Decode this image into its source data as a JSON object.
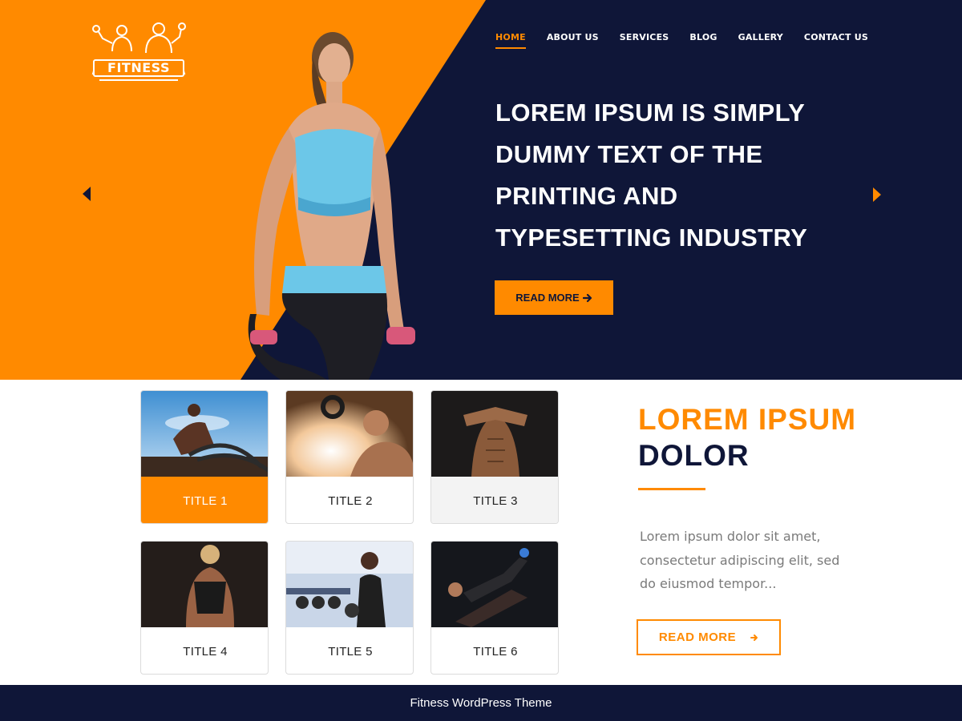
{
  "brand": {
    "logo_text": "FITNESS"
  },
  "colors": {
    "accent": "#ff8a00",
    "navy": "#0f1638"
  },
  "nav": {
    "items": [
      {
        "label": "HOME",
        "active": true
      },
      {
        "label": "ABOUT US"
      },
      {
        "label": "SERVICES"
      },
      {
        "label": "BLOG"
      },
      {
        "label": "GALLERY"
      },
      {
        "label": "CONTACT US"
      }
    ]
  },
  "hero": {
    "title": "LOREM IPSUM IS SIMPLY DUMMY TEXT OF THE PRINTING AND TYPESETTING INDUSTRY",
    "button_label": "READ MORE",
    "button_icon": "arrow-right-icon",
    "prev_icon": "caret-left-icon",
    "next_icon": "caret-right-icon"
  },
  "cards": [
    {
      "title": "TITLE 1"
    },
    {
      "title": "TITLE 2"
    },
    {
      "title": "TITLE 3"
    },
    {
      "title": "TITLE 4"
    },
    {
      "title": "TITLE 5"
    },
    {
      "title": "TITLE 6"
    }
  ],
  "section": {
    "title_line1": "LOREM IPSUM",
    "title_line2": "DOLOR",
    "text": "Lorem ipsum dolor sit amet, consectetur adipiscing elit, sed do eiusmod tempor...",
    "button_label": "READ MORE",
    "button_icon": "arrow-right-icon"
  },
  "footer": {
    "text": "Fitness WordPress Theme"
  }
}
